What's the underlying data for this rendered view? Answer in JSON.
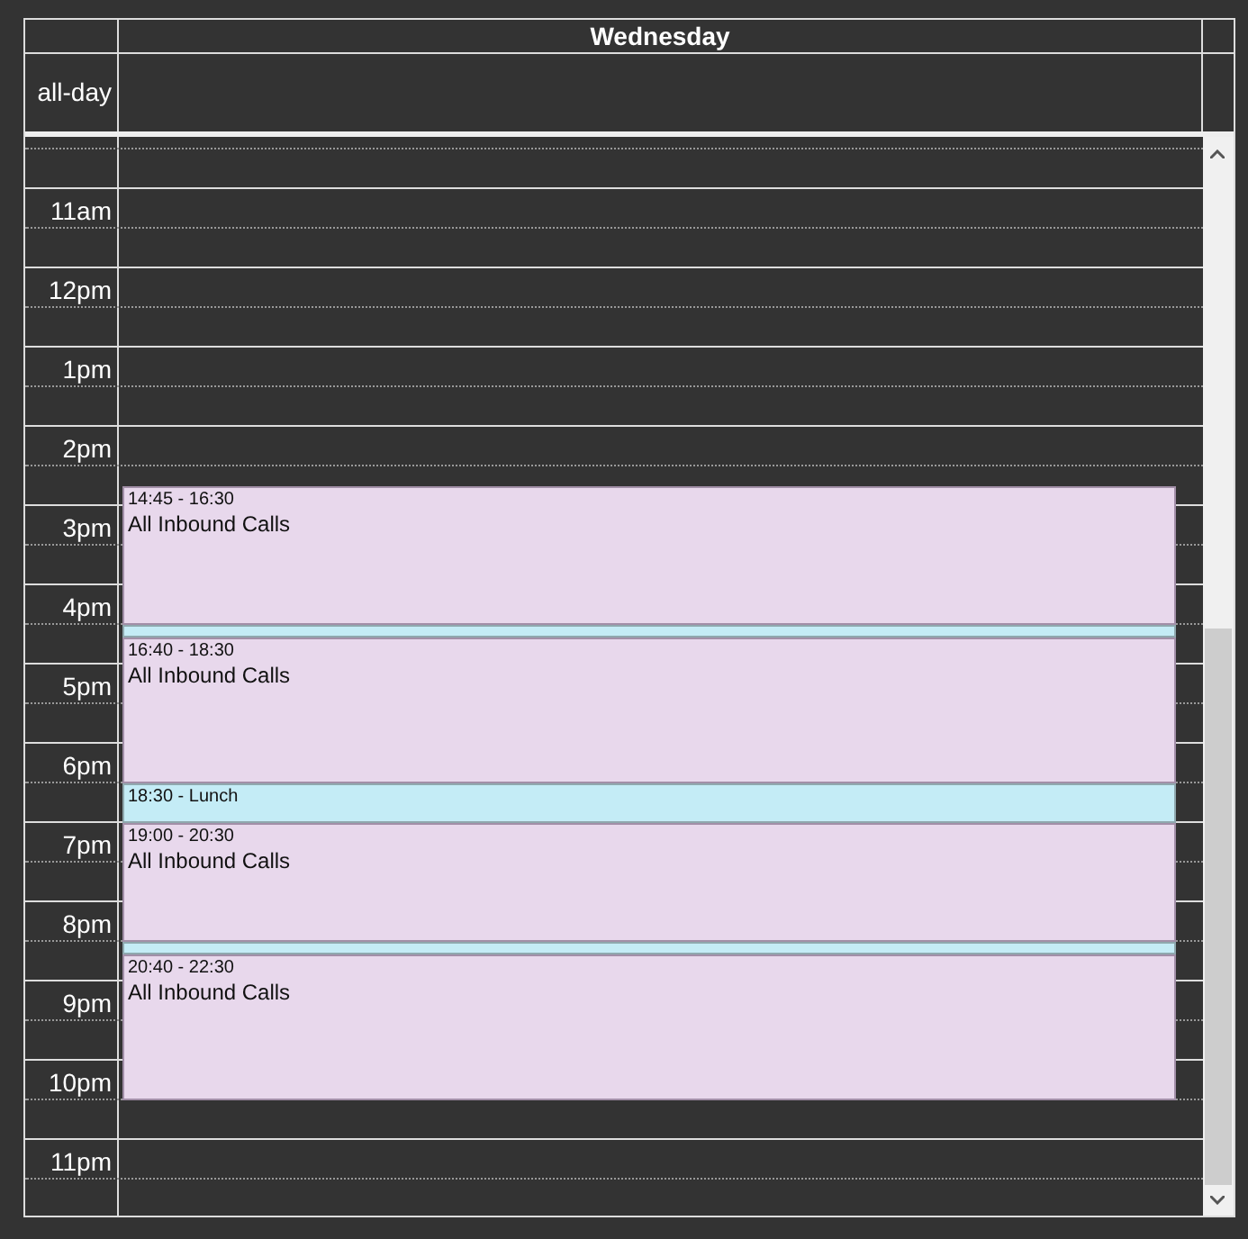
{
  "header": {
    "day": "Wednesday"
  },
  "all_day": {
    "label": "all-day"
  },
  "hours": [
    "11am",
    "12pm",
    "1pm",
    "2pm",
    "3pm",
    "4pm",
    "5pm",
    "6pm",
    "7pm",
    "8pm",
    "9pm",
    "10pm",
    "11pm"
  ],
  "events": [
    {
      "kind": "call",
      "time": "14:45 - 16:30",
      "title": "All Inbound Calls"
    },
    {
      "kind": "break"
    },
    {
      "kind": "call",
      "time": "16:40 - 18:30",
      "title": "All Inbound Calls"
    },
    {
      "kind": "lunch",
      "time": "18:30 - Lunch"
    },
    {
      "kind": "call",
      "time": "19:00 - 20:30",
      "title": "All Inbound Calls"
    },
    {
      "kind": "break"
    },
    {
      "kind": "call",
      "time": "20:40 - 22:30",
      "title": "All Inbound Calls"
    }
  ]
}
